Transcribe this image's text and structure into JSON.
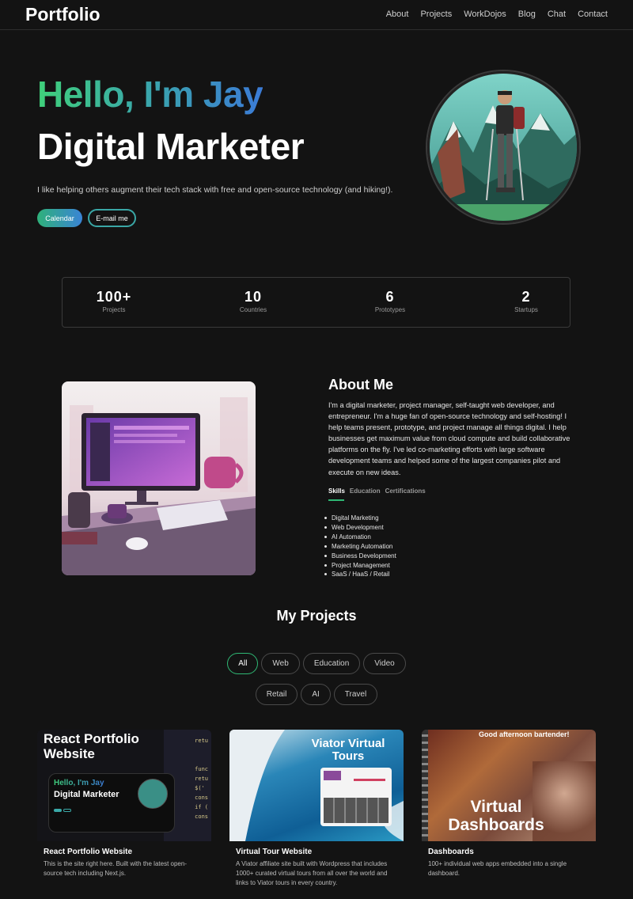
{
  "nav": {
    "brand": "Portfolio",
    "links": [
      "About",
      "Projects",
      "WorkDojos",
      "Blog",
      "Chat",
      "Contact"
    ]
  },
  "hero": {
    "greeting": "Hello, I'm Jay",
    "role": "Digital Marketer",
    "tagline": "I like helping others augment their tech stack with free and open-source technology (and hiking!).",
    "calendar_label": "Calendar",
    "email_label": "E-mail me"
  },
  "stats": [
    {
      "value": "100+",
      "label": "Projects"
    },
    {
      "value": "10",
      "label": "Countries"
    },
    {
      "value": "6",
      "label": "Prototypes"
    },
    {
      "value": "2",
      "label": "Startups"
    }
  ],
  "about": {
    "title": "About Me",
    "text": "I'm a digital marketer, project manager, self-taught web developer, and entrepreneur. I'm a huge fan of open-source technology and self-hosting! I help teams present, prototype, and project manage all things digital. I help businesses get maximum value from cloud compute and build collaborative platforms on the fly. I've led co-marketing efforts with large software development teams and helped some of the largest companies pilot and execute on new ideas.",
    "tabs": [
      "Skills",
      "Education",
      "Certifications"
    ],
    "skills": [
      "Digital Marketing",
      "Web Development",
      "AI Automation",
      "Marketing Automation",
      "Business Development",
      "Project Management",
      "SaaS / HaaS / Retail"
    ]
  },
  "projects": {
    "title": "My Projects",
    "filters_row1": [
      "All",
      "Web",
      "Education",
      "Video"
    ],
    "filters_row2": [
      "Retail",
      "AI",
      "Travel"
    ],
    "cards": [
      {
        "title": "React Portfolio Website",
        "description": "This is the site right here. Built with the latest open-source tech including Next.js.",
        "thumb_heading": "React Portfolio Website",
        "thumb_hello": "Hello, I'm Jay",
        "thumb_role": "Digital Marketer"
      },
      {
        "title": "Virtual Tour Website",
        "description": "A Viator affiliate site built with Wordpress that includes 1000+ curated virtual tours from all over the world and links to Viator tours in every country.",
        "thumb_heading": "Viator Virtual Tours"
      },
      {
        "title": "Dashboards",
        "description": "100+ individual web apps embedded into a single dashboard.",
        "thumb_top": "Good afternoon bartender!",
        "thumb_heading": "Virtual Dashboards"
      }
    ]
  },
  "colors": {
    "background": "#131313",
    "accent_green": "#3fd07a",
    "accent_blue": "#3b7bd6"
  }
}
